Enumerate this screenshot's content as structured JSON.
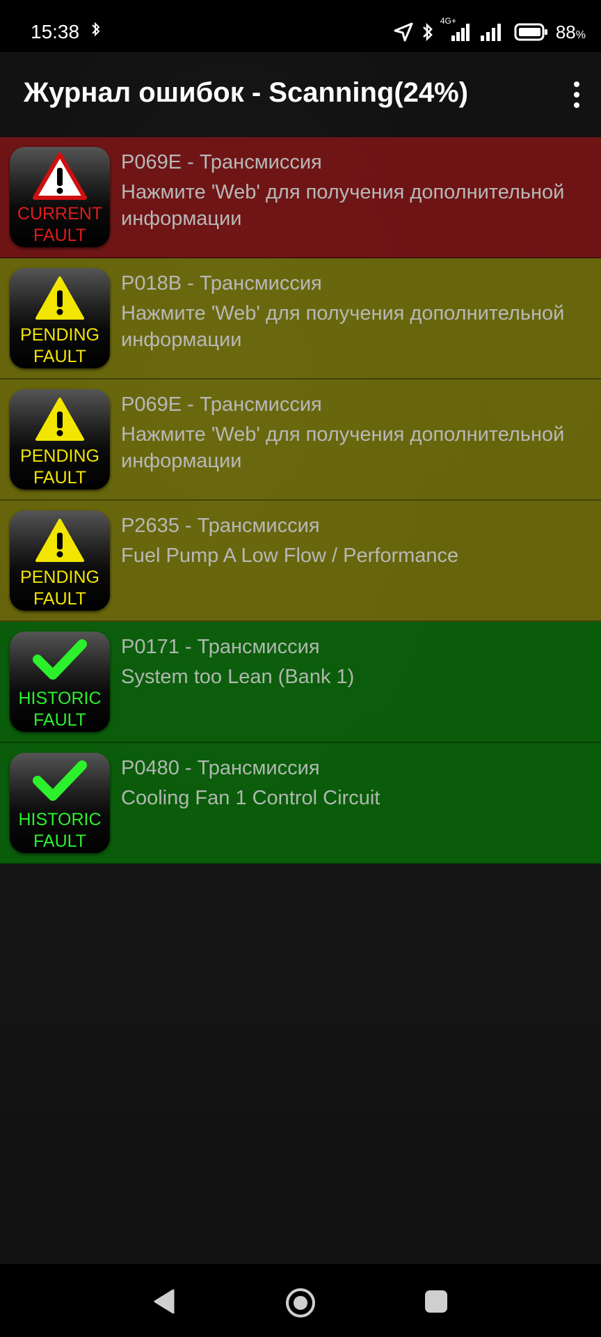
{
  "status_bar": {
    "time": "15:38",
    "network": "4G+",
    "battery_percent": "88",
    "battery_unit": "%",
    "icons": [
      "bluetooth-icon",
      "location-arrow-icon",
      "bluetooth-icon",
      "signal-icon",
      "signal-icon",
      "battery-icon"
    ]
  },
  "app_bar": {
    "title": "Журнал ошибок - Scanning(24%)",
    "menu_icon": "more-vertical-icon"
  },
  "colors": {
    "current": "#801214",
    "pending": "#7a7808",
    "historic": "#086e08"
  },
  "faults": [
    {
      "status": "current",
      "badge_line1": "CURRENT",
      "badge_line2": "FAULT",
      "badge_icon": "warning-triangle-icon",
      "code": "P069E - Трансмиссия",
      "description": "Нажмите 'Web' для получения дополнительной информации"
    },
    {
      "status": "pending",
      "badge_line1": "PENDING",
      "badge_line2": "FAULT",
      "badge_icon": "warning-triangle-icon",
      "code": "P018B - Трансмиссия",
      "description": "Нажмите 'Web' для получения дополнительной информации"
    },
    {
      "status": "pending",
      "badge_line1": "PENDING",
      "badge_line2": "FAULT",
      "badge_icon": "warning-triangle-icon",
      "code": "P069E - Трансмиссия",
      "description": "Нажмите 'Web' для получения дополнительной информации"
    },
    {
      "status": "pending",
      "badge_line1": "PENDING",
      "badge_line2": "FAULT",
      "badge_icon": "warning-triangle-icon",
      "code": "P2635 - Трансмиссия",
      "description": "Fuel Pump A Low Flow / Performance"
    },
    {
      "status": "historic",
      "badge_line1": "HISTORIC",
      "badge_line2": "FAULT",
      "badge_icon": "checkmark-icon",
      "code": "P0171 - Трансмиссия",
      "description": "System too Lean (Bank 1)"
    },
    {
      "status": "historic",
      "badge_line1": "HISTORIC",
      "badge_line2": "FAULT",
      "badge_icon": "checkmark-icon",
      "code": "P0480 - Трансмиссия",
      "description": "Cooling Fan 1 Control Circuit"
    }
  ],
  "nav_bar": {
    "buttons": [
      "back-icon",
      "home-icon",
      "recents-icon"
    ]
  }
}
